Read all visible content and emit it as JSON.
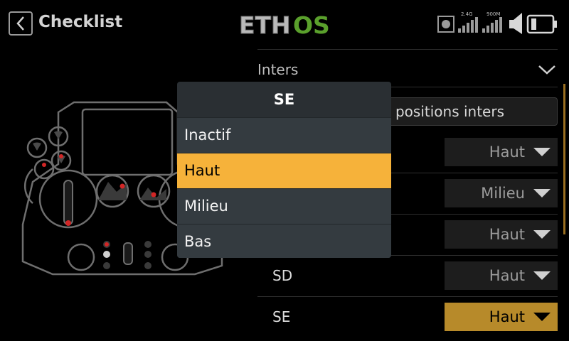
{
  "header": {
    "title": "Checklist",
    "logo_text_eth": "ETH",
    "logo_text_os": "OS",
    "rf_label_1": "2.4G",
    "rf_label_2": "900M"
  },
  "section": {
    "label": "Inters"
  },
  "reset_button": {
    "label": "positions inters"
  },
  "rows": [
    {
      "label": "",
      "value": "Haut",
      "selected": false
    },
    {
      "label": "",
      "value": "Milieu",
      "selected": false
    },
    {
      "label": "",
      "value": "Haut",
      "selected": false
    },
    {
      "label": "SD",
      "value": "Haut",
      "selected": false
    },
    {
      "label": "SE",
      "value": "Haut",
      "selected": true
    }
  ],
  "popup": {
    "title": "SE",
    "options": [
      "Inactif",
      "Haut",
      "Milieu",
      "Bas"
    ],
    "active_index": 1
  },
  "icons": [
    "chevron-left-icon",
    "chevron-down-icon",
    "caret-down-icon",
    "volume-icon",
    "battery-icon",
    "signal-icon"
  ],
  "colors": {
    "accent": "#f6b23a",
    "selected_field": "#b78a2a",
    "logo_green": "#5aa02c",
    "radio_marker": "#d22626"
  }
}
